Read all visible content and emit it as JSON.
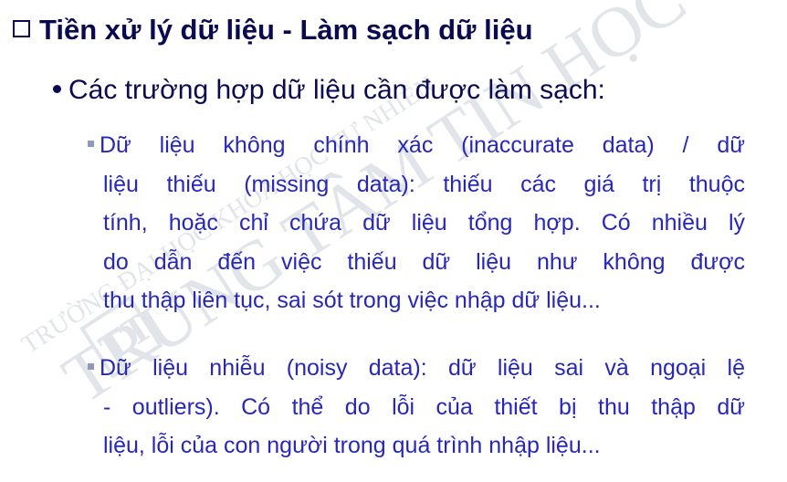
{
  "slide": {
    "title": "Tiền xử lý dữ liệu - Làm sạch dữ liệu",
    "level1": "Các trường hợp dữ liệu cần được làm sạch:",
    "items": [
      {
        "lines": [
          "Dữ liệu không chính xác (inaccurate data) / dữ",
          "liệu thiếu (missing data): thiếu các giá trị thuộc",
          "tính, hoặc chỉ chứa dữ liệu tổng hợp. Có nhiều lý",
          "do dẫn đến việc thiếu dữ liệu như không được",
          "thu thập liên tục, sai sót trong việc nhập dữ liệu..."
        ]
      },
      {
        "lines": [
          "Dữ liệu nhiễu (noisy data): dữ liệu sai và ngoại lệ",
          "- outliers). Có thể do lỗi của thiết bị thu thập dữ",
          "liệu, lỗi của con người trong quá trình nhập liệu..."
        ]
      }
    ]
  },
  "watermark": {
    "line1": "TRƯỜNG ĐẠI HỌC KHOA HỌC TỰ NHIÊN",
    "line2": "TRUNG TÂM TIN HỌC",
    "logo": "TT"
  },
  "colors": {
    "title": "#0a0a50",
    "body": "#2727b8",
    "bullet": "#8e9ab8",
    "watermark": "#c9ced8"
  }
}
